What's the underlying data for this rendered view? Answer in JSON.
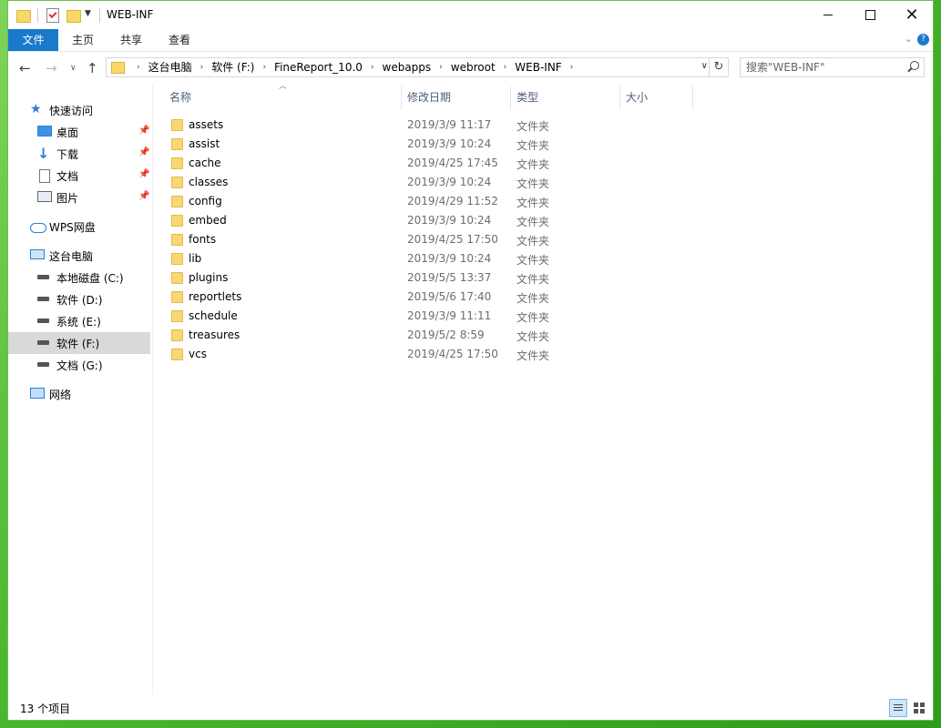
{
  "window": {
    "title": "WEB-INF"
  },
  "ribbon": {
    "tabs": [
      {
        "label": "文件"
      },
      {
        "label": "主页"
      },
      {
        "label": "共享"
      },
      {
        "label": "查看"
      }
    ]
  },
  "address_bar": {
    "crumbs": [
      "这台电脑",
      "软件 (F:)",
      "FineReport_10.0",
      "webapps",
      "webroot",
      "WEB-INF"
    ]
  },
  "search": {
    "placeholder": "搜索\"WEB-INF\""
  },
  "sidebar": {
    "quick_access": "快速访问",
    "pinned": [
      {
        "label": "桌面",
        "icon": "desktop-icon"
      },
      {
        "label": "下载",
        "icon": "download-icon"
      },
      {
        "label": "文档",
        "icon": "document-icon"
      },
      {
        "label": "图片",
        "icon": "picture-icon"
      }
    ],
    "wps": "WPS网盘",
    "this_pc": "这台电脑",
    "drives": [
      {
        "label": "本地磁盘 (C:)",
        "selected": false
      },
      {
        "label": "软件 (D:)",
        "selected": false
      },
      {
        "label": "系统 (E:)",
        "selected": false
      },
      {
        "label": "软件 (F:)",
        "selected": true
      },
      {
        "label": "文档 (G:)",
        "selected": false
      }
    ],
    "network": "网络"
  },
  "columns": {
    "name": "名称",
    "modified": "修改日期",
    "type": "类型",
    "size": "大小"
  },
  "files": [
    {
      "name": "assets",
      "modified": "2019/3/9 11:17",
      "type": "文件夹"
    },
    {
      "name": "assist",
      "modified": "2019/3/9 10:24",
      "type": "文件夹"
    },
    {
      "name": "cache",
      "modified": "2019/4/25 17:45",
      "type": "文件夹"
    },
    {
      "name": "classes",
      "modified": "2019/3/9 10:24",
      "type": "文件夹"
    },
    {
      "name": "config",
      "modified": "2019/4/29 11:52",
      "type": "文件夹"
    },
    {
      "name": "embed",
      "modified": "2019/3/9 10:24",
      "type": "文件夹"
    },
    {
      "name": "fonts",
      "modified": "2019/4/25 17:50",
      "type": "文件夹"
    },
    {
      "name": "lib",
      "modified": "2019/3/9 10:24",
      "type": "文件夹"
    },
    {
      "name": "plugins",
      "modified": "2019/5/5 13:37",
      "type": "文件夹"
    },
    {
      "name": "reportlets",
      "modified": "2019/5/6 17:40",
      "type": "文件夹"
    },
    {
      "name": "schedule",
      "modified": "2019/3/9 11:11",
      "type": "文件夹"
    },
    {
      "name": "treasures",
      "modified": "2019/5/2 8:59",
      "type": "文件夹"
    },
    {
      "name": "vcs",
      "modified": "2019/4/25 17:50",
      "type": "文件夹"
    }
  ],
  "status": {
    "item_count": "13 个项目"
  },
  "colors": {
    "file_tab": "#1979ca",
    "selected_nav": "#d9d9d9",
    "folder": "#f8d775",
    "desktop_green": "#4cb82e"
  }
}
